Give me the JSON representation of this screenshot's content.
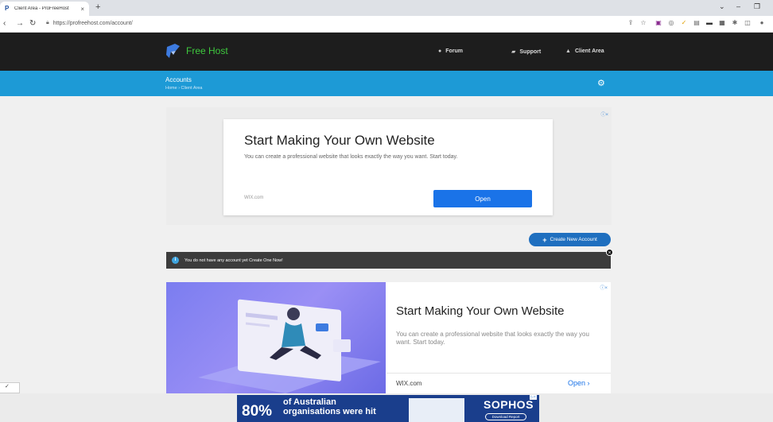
{
  "browser": {
    "tab_title": "Client Area - ProFreeHost",
    "tab_close": "×",
    "new_tab": "+",
    "url": "https://profreehost.com/account/",
    "window_controls": [
      "⌄",
      "–",
      "❐"
    ]
  },
  "header": {
    "logo_text": "Free Host",
    "nav": [
      {
        "label": "Forum"
      },
      {
        "label": "Support"
      },
      {
        "label": "Client Area"
      }
    ]
  },
  "subheader": {
    "title": "Accounts",
    "breadcrumb": "Home  ›  Client Area"
  },
  "ad1": {
    "headline": "Start Making Your Own Website",
    "body": "You can create a professional website that looks exactly the way you want. Start today.",
    "source": "WIX.com",
    "button": "Open",
    "adchoice": "ⓘ×"
  },
  "actions": {
    "create_button": "Create New Account"
  },
  "alert": {
    "message": "You do not have any account yet Create One Now!",
    "close": "×"
  },
  "ad2": {
    "headline": "Start Making Your Own Website",
    "body": "You can create a professional website that looks exactly the way you want. Start today.",
    "source": "WIX.com",
    "button": "Open  ›",
    "adchoice": "ⓘ×"
  },
  "banner": {
    "stat": "80%",
    "line1": "of Australian",
    "line2": "organisations were hit",
    "brand": "SOPHOS",
    "button": "Download Report"
  },
  "colors": {
    "header_bg": "#1d1d1d",
    "accent_blue": "#1d9ad6",
    "logo_green": "#3ec93e",
    "button_blue": "#1a73e8"
  }
}
